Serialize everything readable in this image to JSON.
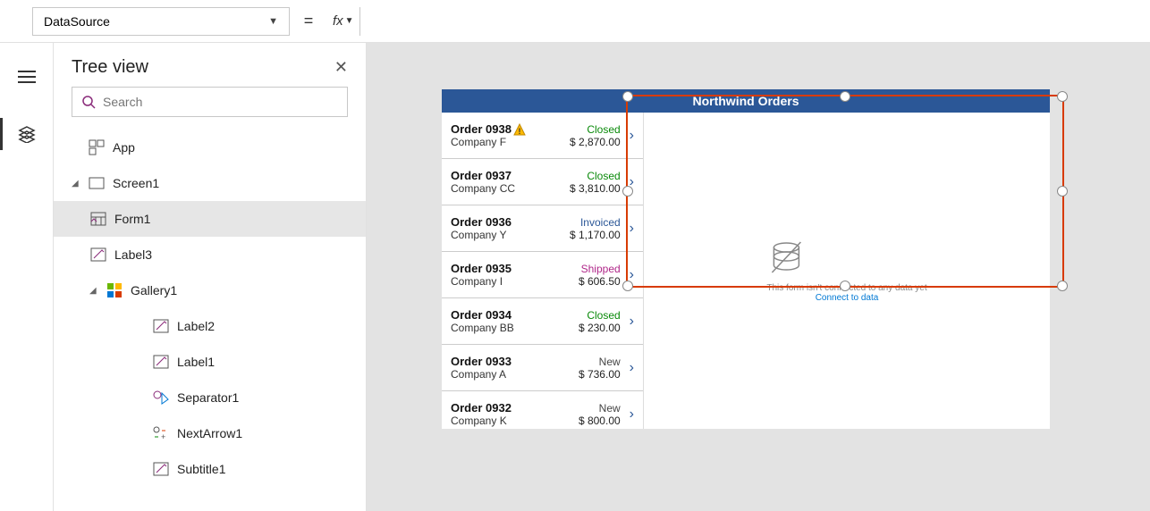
{
  "formula": {
    "property": "DataSource",
    "equals": "=",
    "fx": "fx",
    "value": ""
  },
  "tree": {
    "panel_title": "Tree view",
    "search_placeholder": "Search",
    "items": {
      "app": "App",
      "screen1": "Screen1",
      "form1": "Form1",
      "label3": "Label3",
      "gallery1": "Gallery1",
      "label2": "Label2",
      "label1": "Label1",
      "separator1": "Separator1",
      "nextarrow1": "NextArrow1",
      "subtitle1": "Subtitle1"
    }
  },
  "canvas": {
    "header": "Northwind Orders",
    "form_empty_msg": "This form isn't connected to any data yet",
    "form_connect_link": "Connect to data",
    "orders": [
      {
        "id": "Order 0938",
        "company": "Company F",
        "status": "Closed",
        "amount": "$ 2,870.00",
        "warn": true
      },
      {
        "id": "Order 0937",
        "company": "Company CC",
        "status": "Closed",
        "amount": "$ 3,810.00",
        "warn": false
      },
      {
        "id": "Order 0936",
        "company": "Company Y",
        "status": "Invoiced",
        "amount": "$ 1,170.00",
        "warn": false
      },
      {
        "id": "Order 0935",
        "company": "Company I",
        "status": "Shipped",
        "amount": "$ 606.50",
        "warn": false
      },
      {
        "id": "Order 0934",
        "company": "Company BB",
        "status": "Closed",
        "amount": "$ 230.00",
        "warn": false
      },
      {
        "id": "Order 0933",
        "company": "Company A",
        "status": "New",
        "amount": "$ 736.00",
        "warn": false
      },
      {
        "id": "Order 0932",
        "company": "Company K",
        "status": "New",
        "amount": "$ 800.00",
        "warn": false
      }
    ]
  }
}
